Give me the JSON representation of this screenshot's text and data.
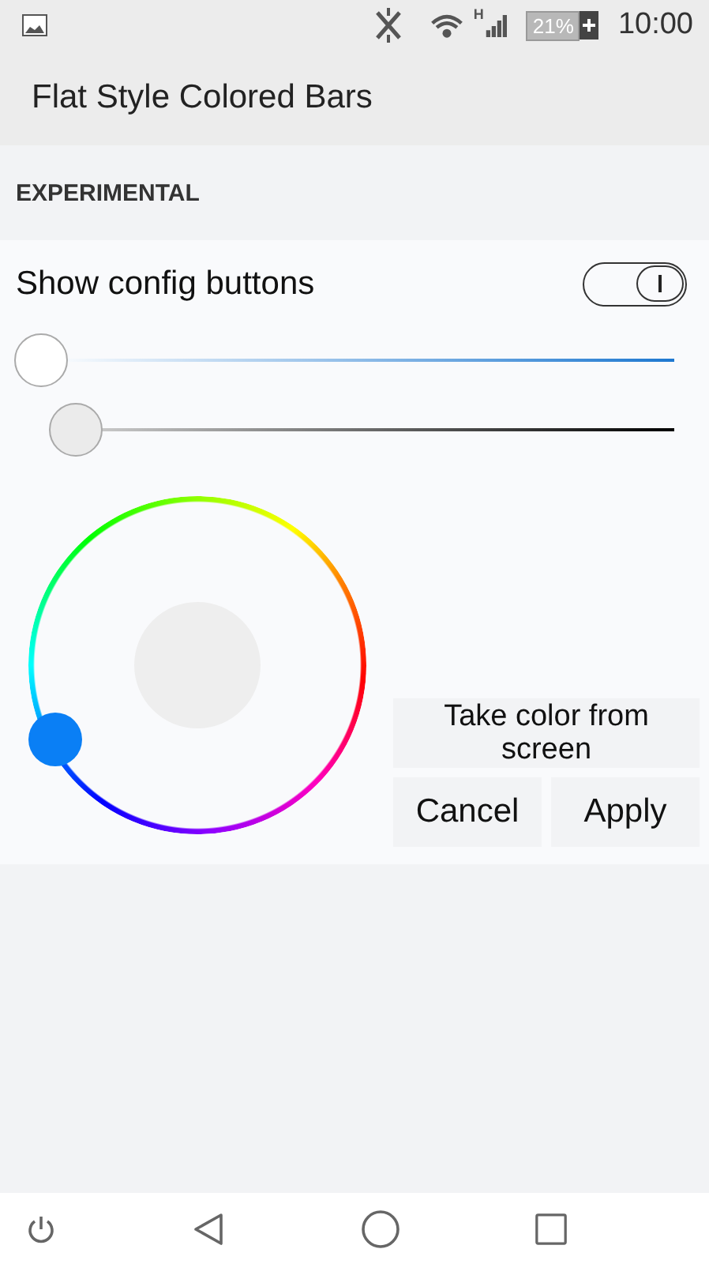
{
  "status_bar": {
    "network_type": "H",
    "battery": "21%",
    "time": "10:00"
  },
  "app_bar": {
    "title": "Flat Style Colored Bars"
  },
  "section": {
    "header": "EXPERIMENTAL"
  },
  "settings": {
    "label": "Show config buttons",
    "on": true
  },
  "sliders": [
    {
      "kind": "saturation",
      "level": 0
    },
    {
      "kind": "brightness",
      "level": 0
    }
  ],
  "buttons": [
    "Take color from screen",
    "Cancel",
    "Apply"
  ]
}
